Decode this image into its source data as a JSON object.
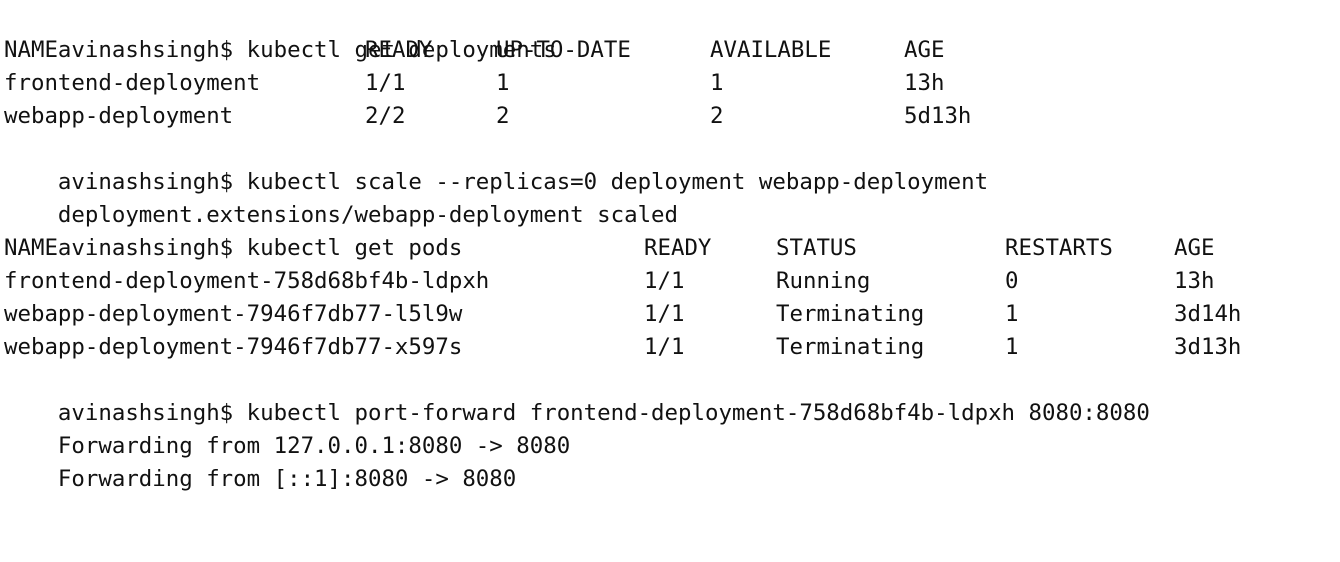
{
  "terminal": {
    "blocks": [
      {
        "prompt": "avinashsingh$ kubectl get deployments",
        "table": {
          "headers": [
            "NAME",
            "READY",
            "UP-TO-DATE",
            "AVAILABLE",
            "AGE"
          ],
          "rows": [
            [
              "frontend-deployment",
              "1/1",
              "1",
              "1",
              "13h"
            ],
            [
              "webapp-deployment",
              "2/2",
              "2",
              "2",
              "5d13h"
            ]
          ]
        }
      },
      {
        "prompt": "avinashsingh$ kubectl scale --replicas=0 deployment webapp-deployment",
        "output": [
          "deployment.extensions/webapp-deployment scaled"
        ]
      },
      {
        "prompt": "avinashsingh$ kubectl get pods",
        "table": {
          "headers": [
            "NAME",
            "READY",
            "STATUS",
            "RESTARTS",
            "AGE"
          ],
          "rows": [
            [
              "frontend-deployment-758d68bf4b-ldpxh",
              "1/1",
              "Running",
              "0",
              "13h"
            ],
            [
              "webapp-deployment-7946f7db77-l5l9w",
              "1/1",
              "Terminating",
              "1",
              "3d14h"
            ],
            [
              "webapp-deployment-7946f7db77-x597s",
              "1/1",
              "Terminating",
              "1",
              "3d13h"
            ]
          ]
        }
      },
      {
        "prompt": "avinashsingh$ kubectl port-forward frontend-deployment-758d68bf4b-ldpxh 8080:8080",
        "output": [
          "Forwarding from 127.0.0.1:8080 -> 8080",
          "Forwarding from [::1]:8080 -> 8080"
        ]
      }
    ]
  }
}
